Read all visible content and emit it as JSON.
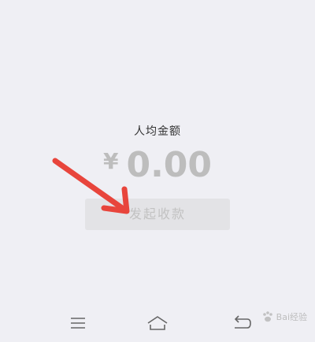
{
  "main": {
    "per_person_label": "人均金额",
    "currency_symbol": "¥",
    "amount": "0.00",
    "collect_button_label": "发起收款"
  },
  "annotation": {
    "arrow_color": "#e8453c"
  },
  "navbar": {
    "menu_icon": "menu-icon",
    "home_icon": "home-icon",
    "back_icon": "back-icon"
  },
  "watermark": {
    "text": "Bai经验"
  },
  "colors": {
    "background": "#efeff4",
    "amount_text": "#bdbdbd",
    "button_bg": "#e3e3e6"
  }
}
